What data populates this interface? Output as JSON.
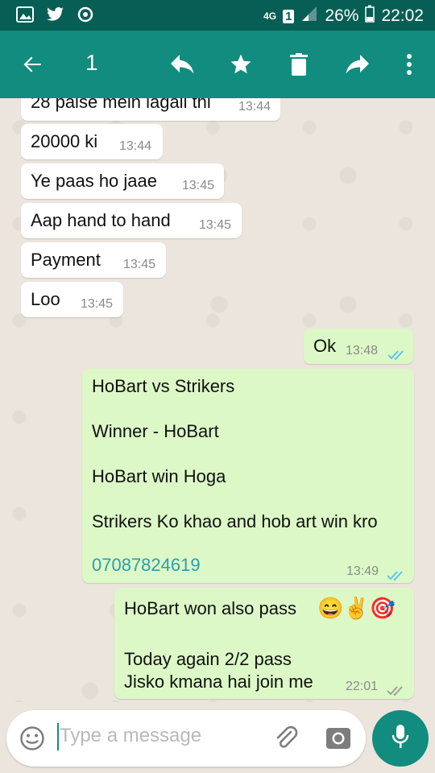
{
  "status_bar": {
    "network": "4G",
    "sim": "1",
    "battery": "26%",
    "time": "22:02"
  },
  "toolbar": {
    "selected_count": "1",
    "icons": [
      "back-arrow-icon",
      "reply-icon",
      "star-icon",
      "delete-icon",
      "forward-icon",
      "more-vert-icon"
    ]
  },
  "messages": [
    {
      "dir": "in",
      "text": "28 paise mein lagali thi",
      "time": "13:44"
    },
    {
      "dir": "in",
      "text": "20000 ki",
      "time": "13:44"
    },
    {
      "dir": "in",
      "text": "Ye paas ho jaae",
      "time": "13:45"
    },
    {
      "dir": "in",
      "text": "Aap hand to hand",
      "time": "13:45"
    },
    {
      "dir": "in",
      "text": "Payment",
      "time": "13:45"
    },
    {
      "dir": "in",
      "text": "Loo",
      "time": "13:45"
    },
    {
      "dir": "out",
      "text": "Ok",
      "time": "13:48",
      "status": "read"
    },
    {
      "dir": "out",
      "lines": [
        "HoBart vs Strikers",
        "Winner - HoBart",
        "HoBart win Hoga",
        "Strikers Ko khao and hob art win kro"
      ],
      "phone": "07087824619",
      "time": "13:49",
      "status": "read"
    },
    {
      "dir": "out",
      "line1": "HoBart won also pass",
      "emojis": "😄✌🎯",
      "line2": "Today again 2/2 pass",
      "line3": "Jisko kmana hai join me",
      "time": "22:01",
      "status": "delivered"
    }
  ],
  "composer": {
    "placeholder": "Type a message"
  },
  "colors": {
    "header": "#128c7e",
    "statusbar": "#075e54",
    "outgoing": "#dcf8c6",
    "incoming": "#ffffff",
    "read_tick": "#4fc3f7",
    "link": "#2a9fb0"
  }
}
